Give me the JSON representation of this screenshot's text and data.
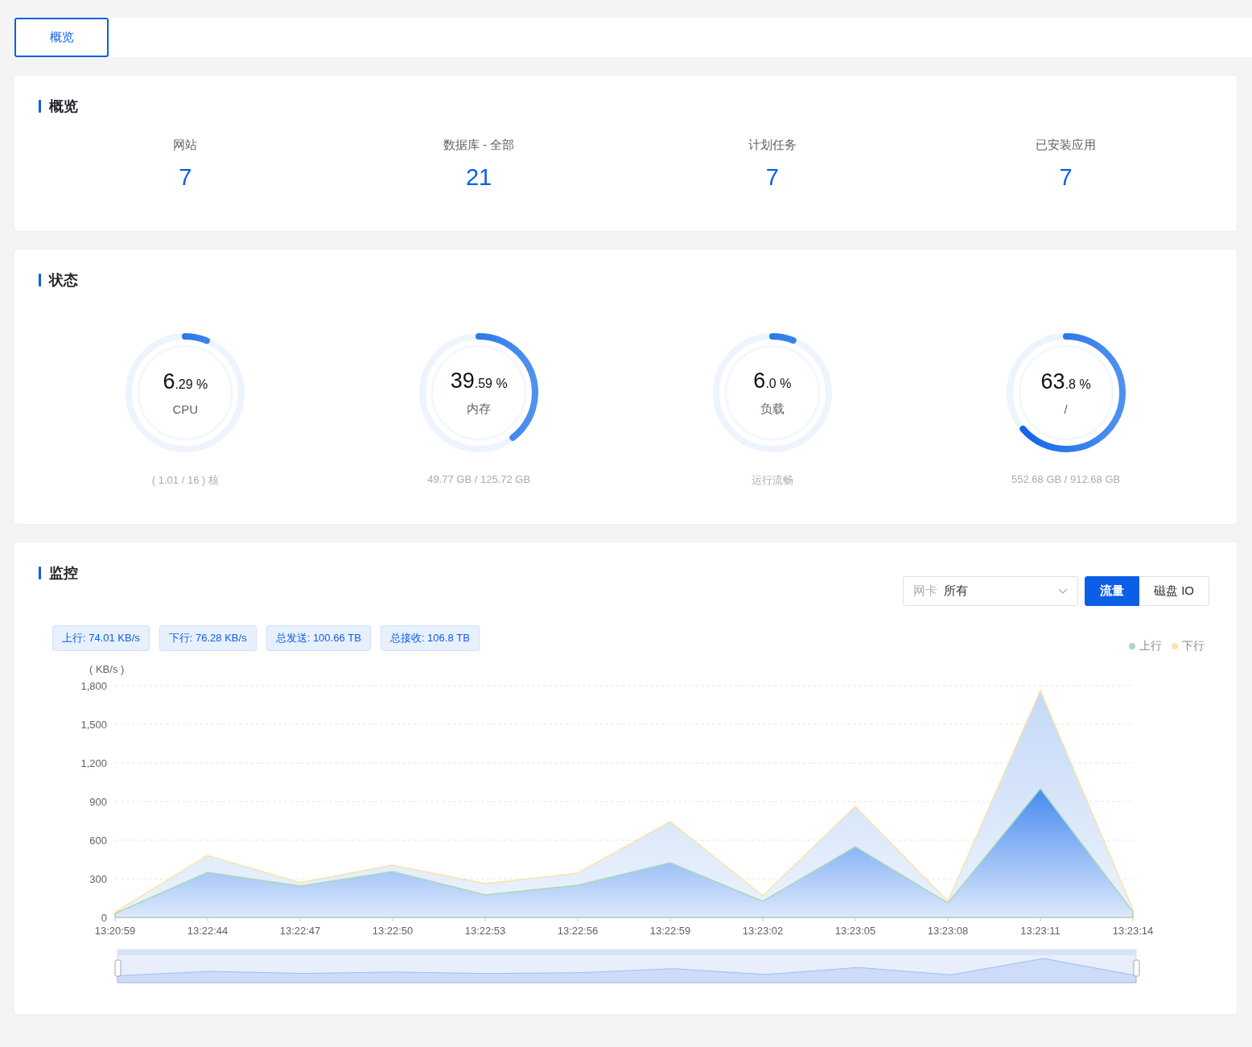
{
  "tabs": [
    {
      "label": "概览",
      "selected": true
    }
  ],
  "overview": {
    "title": "概览",
    "stats": [
      {
        "label": "网站",
        "value": "7"
      },
      {
        "label": "数据库 - 全部",
        "value": "21"
      },
      {
        "label": "计划任务",
        "value": "7"
      },
      {
        "label": "已安装应用",
        "value": "7"
      }
    ]
  },
  "status": {
    "title": "状态",
    "gauges": [
      {
        "integer": "6",
        "decimal": ".29",
        "unit": "%",
        "name": "CPU",
        "level": 0.0629,
        "detail": "( 1.01 / 16 ) 核"
      },
      {
        "integer": "39",
        "decimal": ".59",
        "unit": "%",
        "name": "内存",
        "level": 0.3959,
        "detail": "49.77 GB / 125.72 GB"
      },
      {
        "integer": "6",
        "decimal": ".0",
        "unit": "%",
        "name": "负载",
        "level": 0.06,
        "detail": "运行流畅"
      },
      {
        "integer": "63",
        "decimal": ".8",
        "unit": "%",
        "name": "/",
        "level": 0.638,
        "detail": "552.68 GB / 912.68 GB"
      }
    ]
  },
  "monitor": {
    "title": "监控",
    "select": {
      "label": "网卡",
      "value": "所有"
    },
    "modes": [
      {
        "label": "流量",
        "selected": true
      },
      {
        "label": "磁盘 IO",
        "selected": false
      }
    ],
    "tags": [
      "上行: 74.01 KB/s",
      "下行: 76.28 KB/s",
      "总发送: 100.66 TB",
      "总接收: 106.8 TB"
    ],
    "chart_data": {
      "type": "area",
      "ylabel": "( KB/s )",
      "categories": [
        "13:20:59",
        "13:22:44",
        "13:22:47",
        "13:22:50",
        "13:22:53",
        "13:22:56",
        "13:22:59",
        "13:23:02",
        "13:23:05",
        "13:23:08",
        "13:23:11",
        "13:23:14"
      ],
      "series": [
        {
          "name": "上行",
          "color": "#a9d8b8",
          "values": [
            30,
            350,
            244,
            356,
            175,
            250,
            425,
            125,
            550,
            112,
            1000,
            44
          ]
        },
        {
          "name": "下行",
          "color": "#f9e3a8",
          "values": [
            40,
            481,
            270,
            406,
            262,
            344,
            744,
            169,
            862,
            125,
            1762,
            62
          ]
        }
      ],
      "ylim": [
        0,
        1800
      ],
      "yticks": [
        0,
        300,
        600,
        900,
        {
          "value": 1200,
          "label": "1,200"
        },
        {
          "value": 1500,
          "label": "1,500"
        },
        {
          "value": 1800,
          "label": "1,800"
        }
      ],
      "grid": true
    }
  }
}
